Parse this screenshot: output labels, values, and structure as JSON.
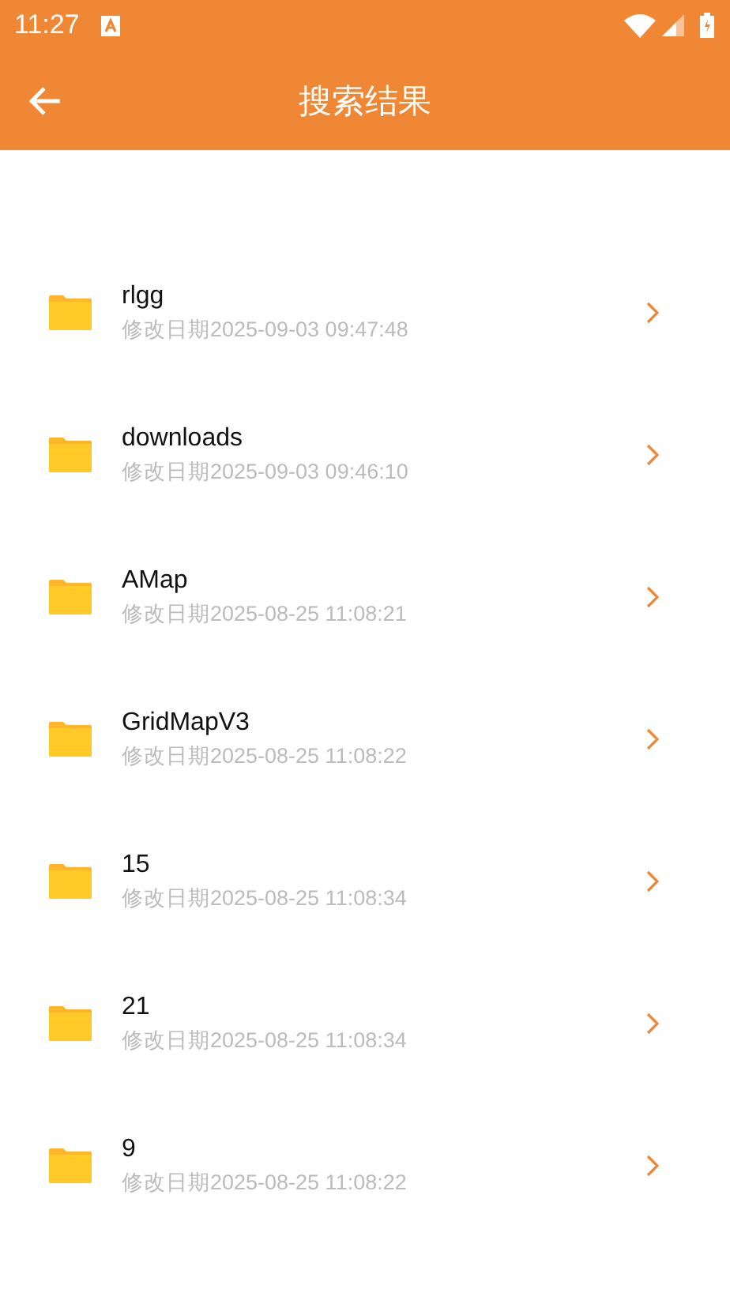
{
  "status_bar": {
    "time": "11:27"
  },
  "app_bar": {
    "title": "搜索结果"
  },
  "results": [
    {
      "name": "rlgg",
      "modified": "修改日期2025-09-03 09:47:48"
    },
    {
      "name": "downloads",
      "modified": "修改日期2025-09-03 09:46:10"
    },
    {
      "name": "AMap",
      "modified": "修改日期2025-08-25 11:08:21"
    },
    {
      "name": "GridMapV3",
      "modified": "修改日期2025-08-25 11:08:22"
    },
    {
      "name": "15",
      "modified": "修改日期2025-08-25 11:08:34"
    },
    {
      "name": "21",
      "modified": "修改日期2025-08-25 11:08:34"
    },
    {
      "name": "9",
      "modified": "修改日期2025-08-25 11:08:22"
    }
  ]
}
